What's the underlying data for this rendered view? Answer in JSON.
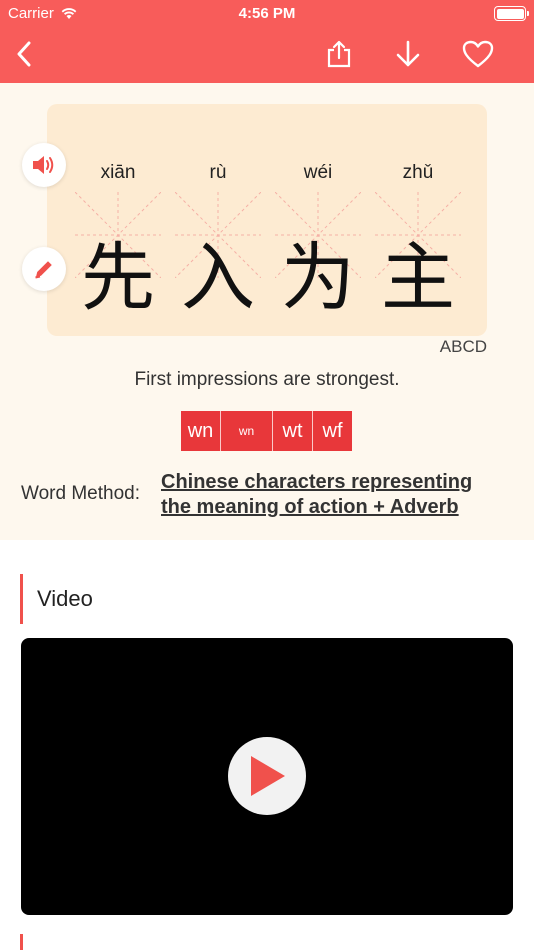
{
  "status_bar": {
    "carrier": "Carrier",
    "time": "4:56 PM"
  },
  "nav": {
    "back_icon": "chevron-left-icon",
    "share_icon": "share-icon",
    "download_icon": "arrow-down-icon",
    "favorite_icon": "heart-icon"
  },
  "word": {
    "characters": [
      {
        "pinyin": "xiān",
        "hanzi": "先"
      },
      {
        "pinyin": "rù",
        "hanzi": "入"
      },
      {
        "pinyin": "wéi",
        "hanzi": "为"
      },
      {
        "pinyin": "zhǔ",
        "hanzi": "主"
      }
    ],
    "level": "ABCD",
    "meaning": "First impressions are strongest."
  },
  "puzzle_pieces": [
    "wn",
    "wn",
    "wt",
    "wf"
  ],
  "word_method": {
    "label": "Word Method:",
    "link": "Chinese characters representing the meaning of action + Adverb"
  },
  "video_section": {
    "title": "Video"
  },
  "colors": {
    "accent": "#f85c5a",
    "card": "#fdebd2",
    "background": "#fef8ee",
    "puzzle": "#e8373a"
  }
}
